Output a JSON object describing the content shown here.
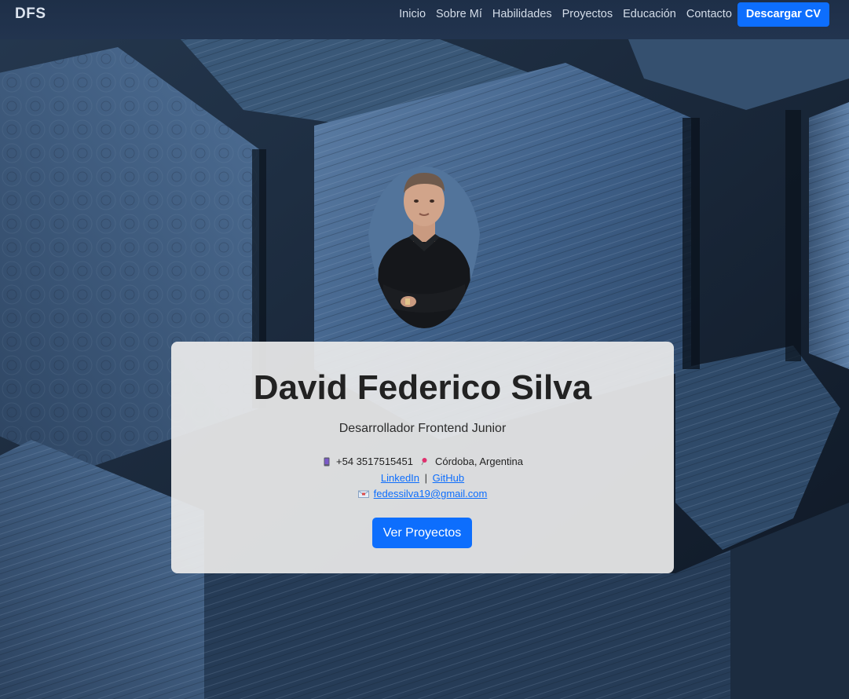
{
  "navbar": {
    "brand": "DFS",
    "links": [
      "Inicio",
      "Sobre Mí",
      "Habilidades",
      "Proyectos",
      "Educación",
      "Contacto"
    ],
    "cv_button": "Descargar CV"
  },
  "hero": {
    "name": "David Federico Silva",
    "role": "Desarrollador Frontend Junior",
    "phone": "+54 3517515451",
    "location": "Córdoba, Argentina",
    "linkedin": "LinkedIn",
    "separator": "|",
    "github": "GitHub",
    "email": "fedessilva19@gmail.com",
    "cta": "Ver Proyectos"
  },
  "icons": {
    "phone": "mobile-phone-icon",
    "location": "pushpin-icon",
    "email": "envelope-icon"
  },
  "colors": {
    "accent": "#0d6efd",
    "navbar": "#1e2f48",
    "card": "#ebebeb"
  }
}
